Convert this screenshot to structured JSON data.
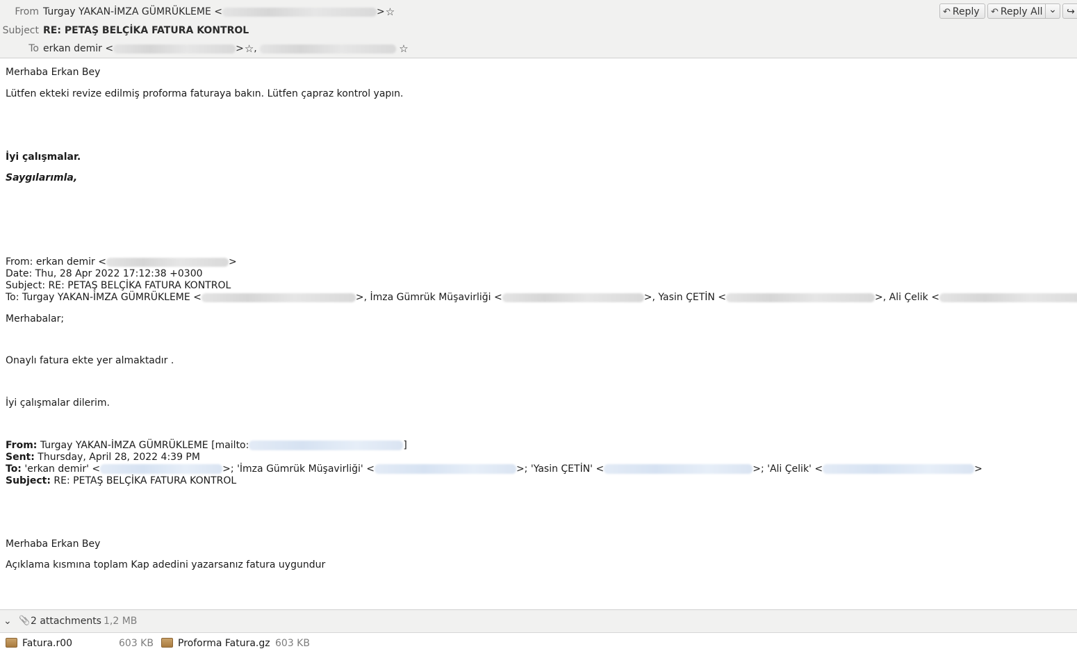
{
  "header": {
    "from_label": "From",
    "from_name": "Turgay YAKAN-İMZA GÜMRÜKLEME <",
    "from_close": ">",
    "subject_label": "Subject",
    "subject": "RE: PETAŞ BELÇİKA FATURA KONTROL",
    "to_label": "To",
    "to_name": "erkan demir <",
    "to_close": ">",
    "to_sep": ",",
    "star_glyph": "☆",
    "buttons": {
      "reply": "Reply",
      "reply_all": "Reply All",
      "reply_icon": "reply-arrow-icon",
      "reply_all_icon": "reply-all-arrow-icon",
      "dropdown_glyph": "⌄",
      "forward_glyph": "↪"
    }
  },
  "message": {
    "greeting": "Merhaba Erkan Bey",
    "line1": "Lütfen ekteki revize edilmiş proforma faturaya bakın. Lütfen çapraz kontrol yapın.",
    "closing1": "İyi çalışmalar.",
    "closing2": "Saygılarımla,",
    "quote1": {
      "from": "From: erkan demir <",
      "from_close": ">",
      "date": "Date: Thu, 28 Apr 2022 17:12:38 +0300",
      "subject": "Subject: RE: PETAŞ BELÇİKA FATURA KONTROL",
      "to_1": "To: Turgay YAKAN-İMZA GÜMRÜKLEME <",
      "to_2": ">, İmza Gümrük Müşavirliği <",
      "to_3": ">, Yasin ÇETİN <",
      "to_4": ">, Ali Çelik <",
      "to_5": ">",
      "greeting": "Merhabalar;",
      "body": "Onaylı fatura ekte yer almaktadır .",
      "closing": "İyi çalışmalar dilerim."
    },
    "quote2": {
      "from_label": "From:",
      "from_value": " Turgay YAKAN-İMZA GÜMRÜKLEME [mailto:",
      "from_close": "]",
      "sent_label": "Sent:",
      "sent_value": " Thursday, April 28, 2022 4:39 PM",
      "to_label": "To:",
      "to_1": " 'erkan demir' <",
      "to_2": ">; 'İmza Gümrük Müşavirliği' <",
      "to_3": ">; 'Yasin ÇETİN' <",
      "to_4": ">; 'Ali Çelik' <",
      "to_5": ">",
      "subject_label": "Subject:",
      "subject_value": " RE: PETAŞ BELÇİKA FATURA KONTROL",
      "greeting": "Merhaba Erkan Bey",
      "body": "Açıklama kısmına toplam Kap adedini yazarsanız fatura uygundur"
    }
  },
  "attachments": {
    "toggle_glyph": "⌄",
    "clip_glyph": "📎",
    "count_label": "2 attachments",
    "total_size": "1,2 MB",
    "items": [
      {
        "name": "Fatura.r00",
        "size": "603 KB",
        "icon": "archive-icon"
      },
      {
        "name": "Proforma Fatura.gz",
        "size": "603 KB",
        "icon": "archive-icon"
      }
    ]
  }
}
